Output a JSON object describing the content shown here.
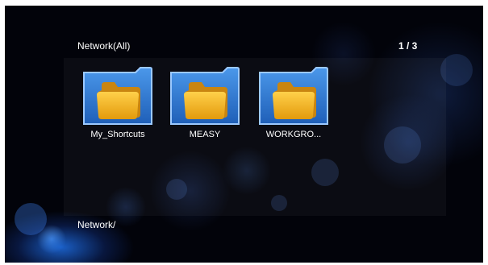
{
  "browser": {
    "title": "Network(All)",
    "page_indicator": "1 / 3",
    "path": "Network/"
  },
  "items": [
    {
      "label": "My_Shortcuts",
      "icon": "folder-icon"
    },
    {
      "label": "MEASY",
      "icon": "folder-icon"
    },
    {
      "label": "WORKGRO...",
      "icon": "folder-icon"
    }
  ],
  "colors": {
    "background": "#02030a",
    "tile_blue": "#2f7fd8",
    "tile_border": "#9cc9ff",
    "folder_yellow": "#f3b51c",
    "text": "#ffffff"
  }
}
